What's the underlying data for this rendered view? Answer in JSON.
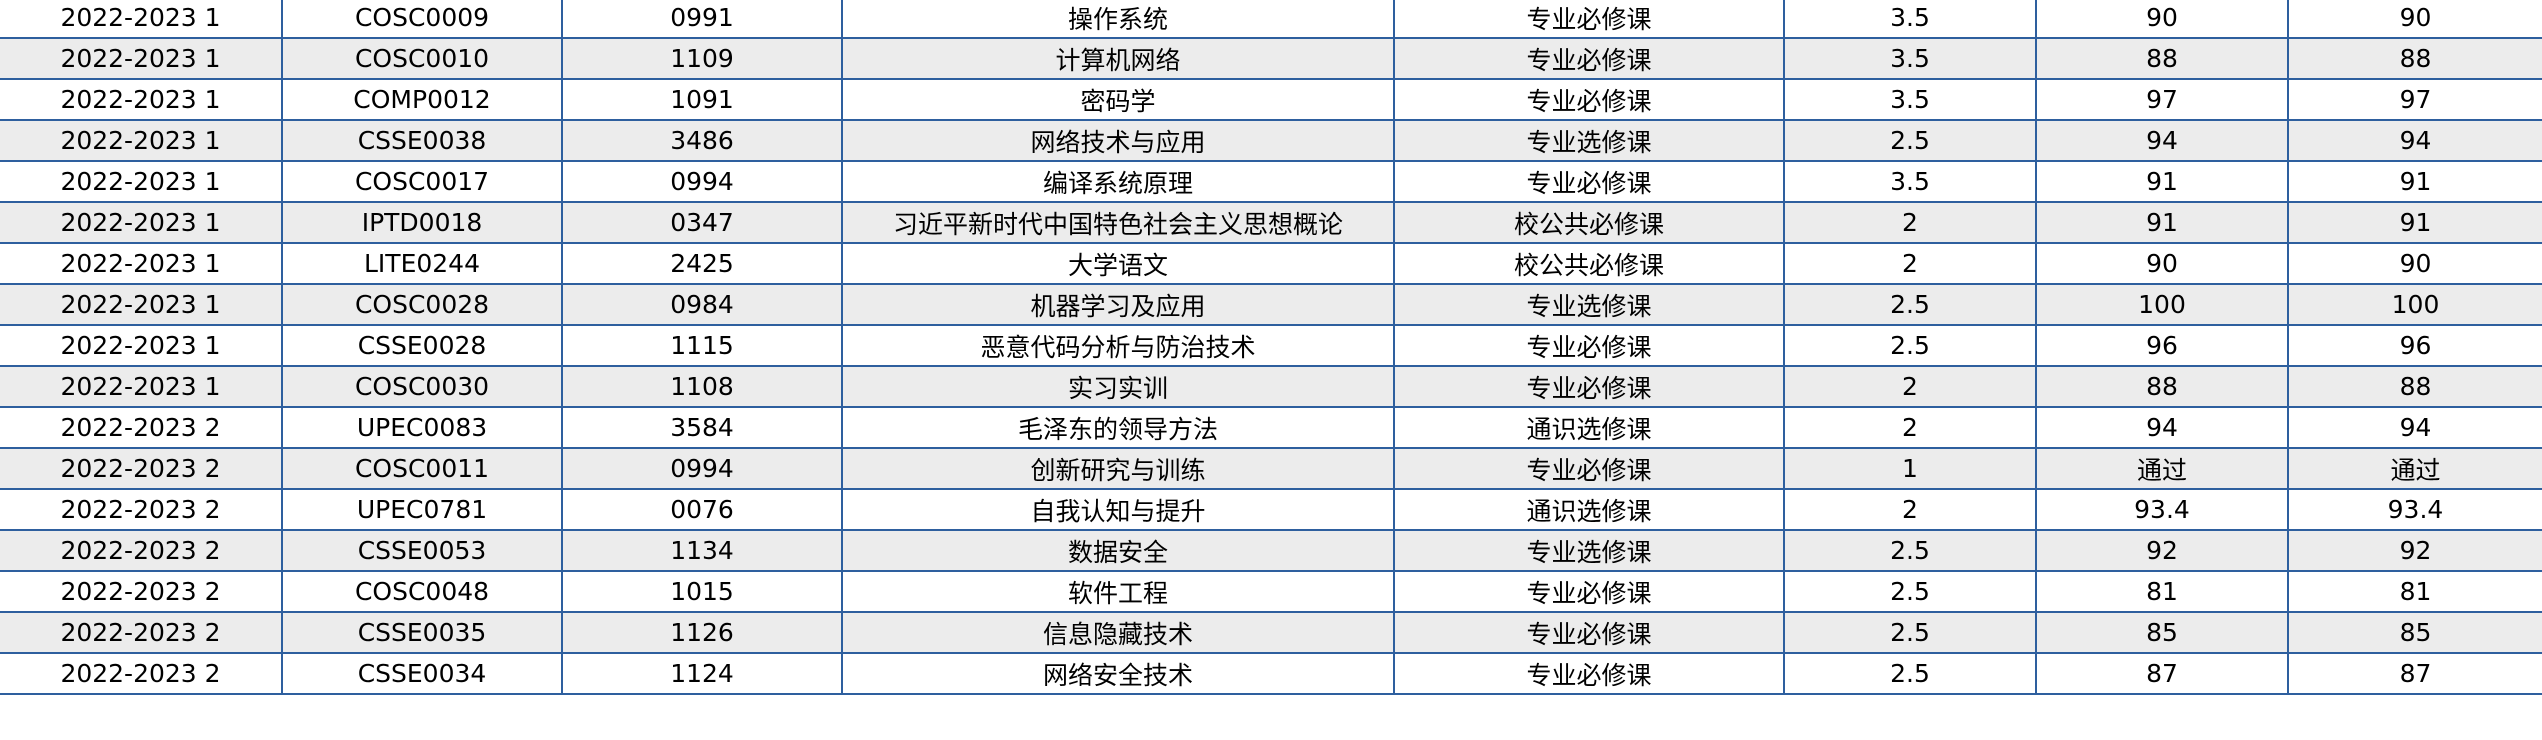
{
  "grades": {
    "rows": [
      [
        "2022-2023 1",
        "COSC0009",
        "0991",
        "操作系统",
        "专业必修课",
        "3.5",
        "90",
        "90"
      ],
      [
        "2022-2023 1",
        "COSC0010",
        "1109",
        "计算机网络",
        "专业必修课",
        "3.5",
        "88",
        "88"
      ],
      [
        "2022-2023 1",
        "COMP0012",
        "1091",
        "密码学",
        "专业必修课",
        "3.5",
        "97",
        "97"
      ],
      [
        "2022-2023 1",
        "CSSE0038",
        "3486",
        "网络技术与应用",
        "专业选修课",
        "2.5",
        "94",
        "94"
      ],
      [
        "2022-2023 1",
        "COSC0017",
        "0994",
        "编译系统原理",
        "专业必修课",
        "3.5",
        "91",
        "91"
      ],
      [
        "2022-2023 1",
        "IPTD0018",
        "0347",
        "习近平新时代中国特色社会主义思想概论",
        "校公共必修课",
        "2",
        "91",
        "91"
      ],
      [
        "2022-2023 1",
        "LITE0244",
        "2425",
        "大学语文",
        "校公共必修课",
        "2",
        "90",
        "90"
      ],
      [
        "2022-2023 1",
        "COSC0028",
        "0984",
        "机器学习及应用",
        "专业选修课",
        "2.5",
        "100",
        "100"
      ],
      [
        "2022-2023 1",
        "CSSE0028",
        "1115",
        "恶意代码分析与防治技术",
        "专业必修课",
        "2.5",
        "96",
        "96"
      ],
      [
        "2022-2023 1",
        "COSC0030",
        "1108",
        "实习实训",
        "专业必修课",
        "2",
        "88",
        "88"
      ],
      [
        "2022-2023 2",
        "UPEC0083",
        "3584",
        "毛泽东的领导方法",
        "通识选修课",
        "2",
        "94",
        "94"
      ],
      [
        "2022-2023 2",
        "COSC0011",
        "0994",
        "创新研究与训练",
        "专业必修课",
        "1",
        "通过",
        "通过"
      ],
      [
        "2022-2023 2",
        "UPEC0781",
        "0076",
        "自我认知与提升",
        "通识选修课",
        "2",
        "93.4",
        "93.4"
      ],
      [
        "2022-2023 2",
        "CSSE0053",
        "1134",
        "数据安全",
        "专业选修课",
        "2.5",
        "92",
        "92"
      ],
      [
        "2022-2023 2",
        "COSC0048",
        "1015",
        "软件工程",
        "专业必修课",
        "2.5",
        "81",
        "81"
      ],
      [
        "2022-2023 2",
        "CSSE0035",
        "1126",
        "信息隐藏技术",
        "专业必修课",
        "2.5",
        "85",
        "85"
      ],
      [
        "2022-2023 2",
        "CSSE0034",
        "1124",
        "网络安全技术",
        "专业必修课",
        "2.5",
        "87",
        "87"
      ]
    ]
  }
}
